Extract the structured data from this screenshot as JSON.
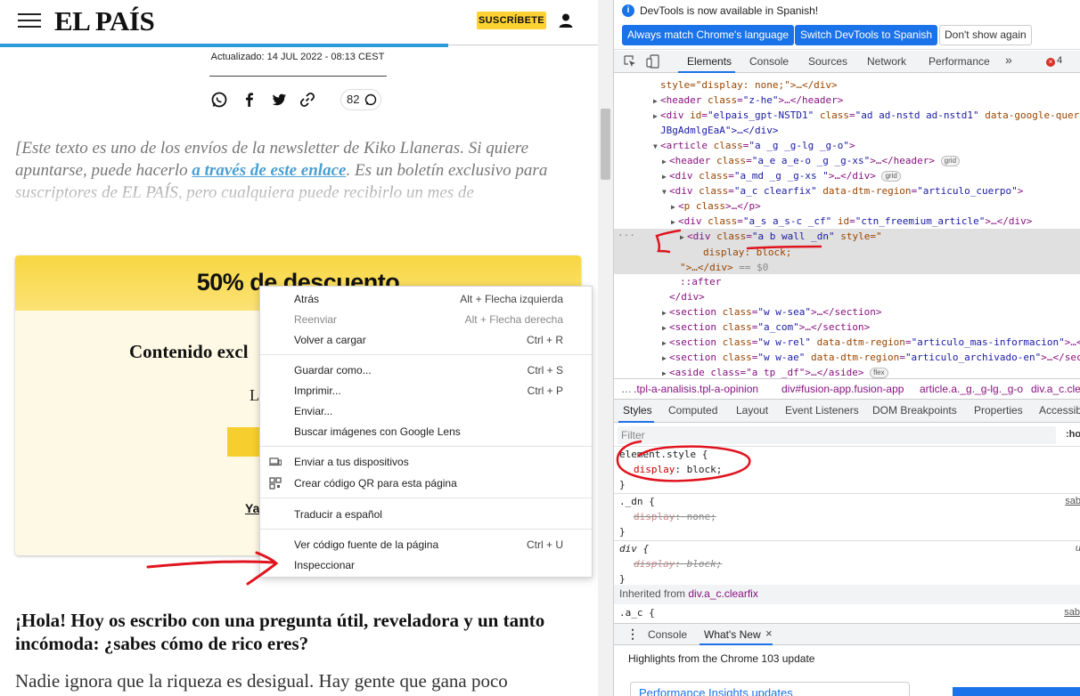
{
  "site": {
    "logo": "EL PAÍS",
    "subscribe": "SUSCRÍBETE",
    "updated": "Actualizado: 14 JUL 2022 - 08:13 CEST",
    "comments_count": "82",
    "intro_1": "[Este texto es uno de los envíos de la newsletter de Kiko Llaneras. Si quiere apuntarse, puede hacerlo ",
    "intro_link": "a través de este enlace",
    "intro_2": ". Es un boletín exclusivo para suscriptores de EL PAÍS, pero cualquiera puede recibirlo un mes de",
    "paywall": {
      "discount": "50% de descuento",
      "exclusive": "Contenido excl",
      "line": "L",
      "ya": "Ya"
    },
    "greeting": "¡Hola! Hoy os escribo con una pregunta útil, reveladora y un tanto incómoda: ¿sabes cómo de rico eres?",
    "body_text": "Nadie ignora que la riqueza es desigual. Hay gente que gana poco"
  },
  "context_menu": {
    "items": [
      {
        "label": "Atrás",
        "shortcut": "Alt + Flecha izquierda"
      },
      {
        "label": "Reenviar",
        "shortcut": "Alt + Flecha derecha"
      },
      {
        "label": "Volver a cargar",
        "shortcut": "Ctrl + R"
      },
      {
        "label": "Guardar como...",
        "shortcut": "Ctrl + S"
      },
      {
        "label": "Imprimir...",
        "shortcut": "Ctrl + P"
      },
      {
        "label": "Enviar...",
        "shortcut": ""
      },
      {
        "label": "Buscar imágenes con Google Lens",
        "shortcut": ""
      },
      {
        "label": "Enviar a tus dispositivos",
        "shortcut": ""
      },
      {
        "label": "Crear código QR para esta página",
        "shortcut": ""
      },
      {
        "label": "Traducir a español",
        "shortcut": ""
      },
      {
        "label": "Ver código fuente de la página",
        "shortcut": "Ctrl + U"
      },
      {
        "label": "Inspeccionar",
        "shortcut": ""
      }
    ]
  },
  "devtools": {
    "info": "DevTools is now available in Spanish!",
    "btn_match": "Always match Chrome's language",
    "btn_switch": "Switch DevTools to Spanish",
    "btn_dont": "Don't show again",
    "tabs": [
      "Elements",
      "Console",
      "Sources",
      "Network",
      "Performance"
    ],
    "more_tabs": "»",
    "errors": "4",
    "dom": {
      "l0a": "style=\"display: none;\">…</div>",
      "l1_tag": "header",
      "l1_attr": "class",
      "l1_val": "\"z-he\"",
      "l1_rest": ">…</header>",
      "l2_id": "\"elpais_gpt-NSTD1\"",
      "l2_class": "\"ad ad-nstd ad-nstd1\"",
      "l2_attr3": "data-google-query",
      "l2b": "JBgAdmlgEaA\">…</div>",
      "l3_class": "\"a _g _g-lg _g-o\"",
      "l4_class": "\"a_e a_e-o _g _g-xs\"",
      "l4_close": ">…</header>",
      "l5_class": "\"a_md _g _g-xs \"",
      "l5_close": ">…</div>",
      "l6_class": "\"a_c clearfix\"",
      "l6_attr2": "data-dtm-region",
      "l6_val2": "\"articulo_cuerpo\"",
      "l7_class": "p class",
      "l7_close": ">…</p>",
      "l8_class": "\"a_s a_s-c _cf\"",
      "l8_id": "\"ctn_freemium_article\"",
      "l8_close": ">…</div>",
      "l9_class": "\"a b wall _dn\"",
      "l9_style": "style=\"",
      "l10": "display: block;",
      "l11": "\">…</div>",
      "l11_eq": "== $0",
      "l12": "::after",
      "l13": "</div>",
      "l14_class": "\"w w-sea\"",
      "l14_close": ">…</section>",
      "l15_class": "\"a_com\"",
      "l15_close": ">…</section>",
      "l16_class": "\"w w-rel\"",
      "l16_attr2": "data-dtm-region",
      "l16_val2": "\"articulo_mas-informacion\"",
      "l17_class": "\"w w-ae\"",
      "l17_attr2": "data-dtm-region",
      "l17_val2": "\"articulo_archivado-en\"",
      "l18": "<aside class=\"a tp _df\">…</aside>",
      "grid": "grid",
      "flex": "flex"
    },
    "breadcrumb": [
      ".tpl-a-analisis.tpl-a-opinion",
      "div#fusion-app.fusion-app",
      "article.a._g._g-lg._g-o",
      "div.a_c.clea"
    ],
    "style_tabs": [
      "Styles",
      "Computed",
      "Layout",
      "Event Listeners",
      "DOM Breakpoints",
      "Properties",
      "Accessibi"
    ],
    "filter_placeholder": "Filter",
    "hov": ":ho",
    "rules": {
      "r1_sel": "element.style {",
      "r1_prop": "display",
      "r1_val": ": block;",
      "close": "}",
      "r2_sel": "._dn {",
      "r2_prop": "display",
      "r2_val": ": none;",
      "r2_src": "sab",
      "r3_sel": "div {",
      "r3_prop": "display",
      "r3_val": ": block;",
      "r3_src": "u",
      "inherited_label": "Inherited from ",
      "inherited_from": "div.a_c.clearfix",
      "r4_sel": ".a_c {",
      "r4_src": "sab"
    },
    "drawer": {
      "tabs": [
        "Console",
        "What's New"
      ],
      "highlights": "Highlights from the Chrome 103 update",
      "card": "Performance Insights updates"
    }
  }
}
